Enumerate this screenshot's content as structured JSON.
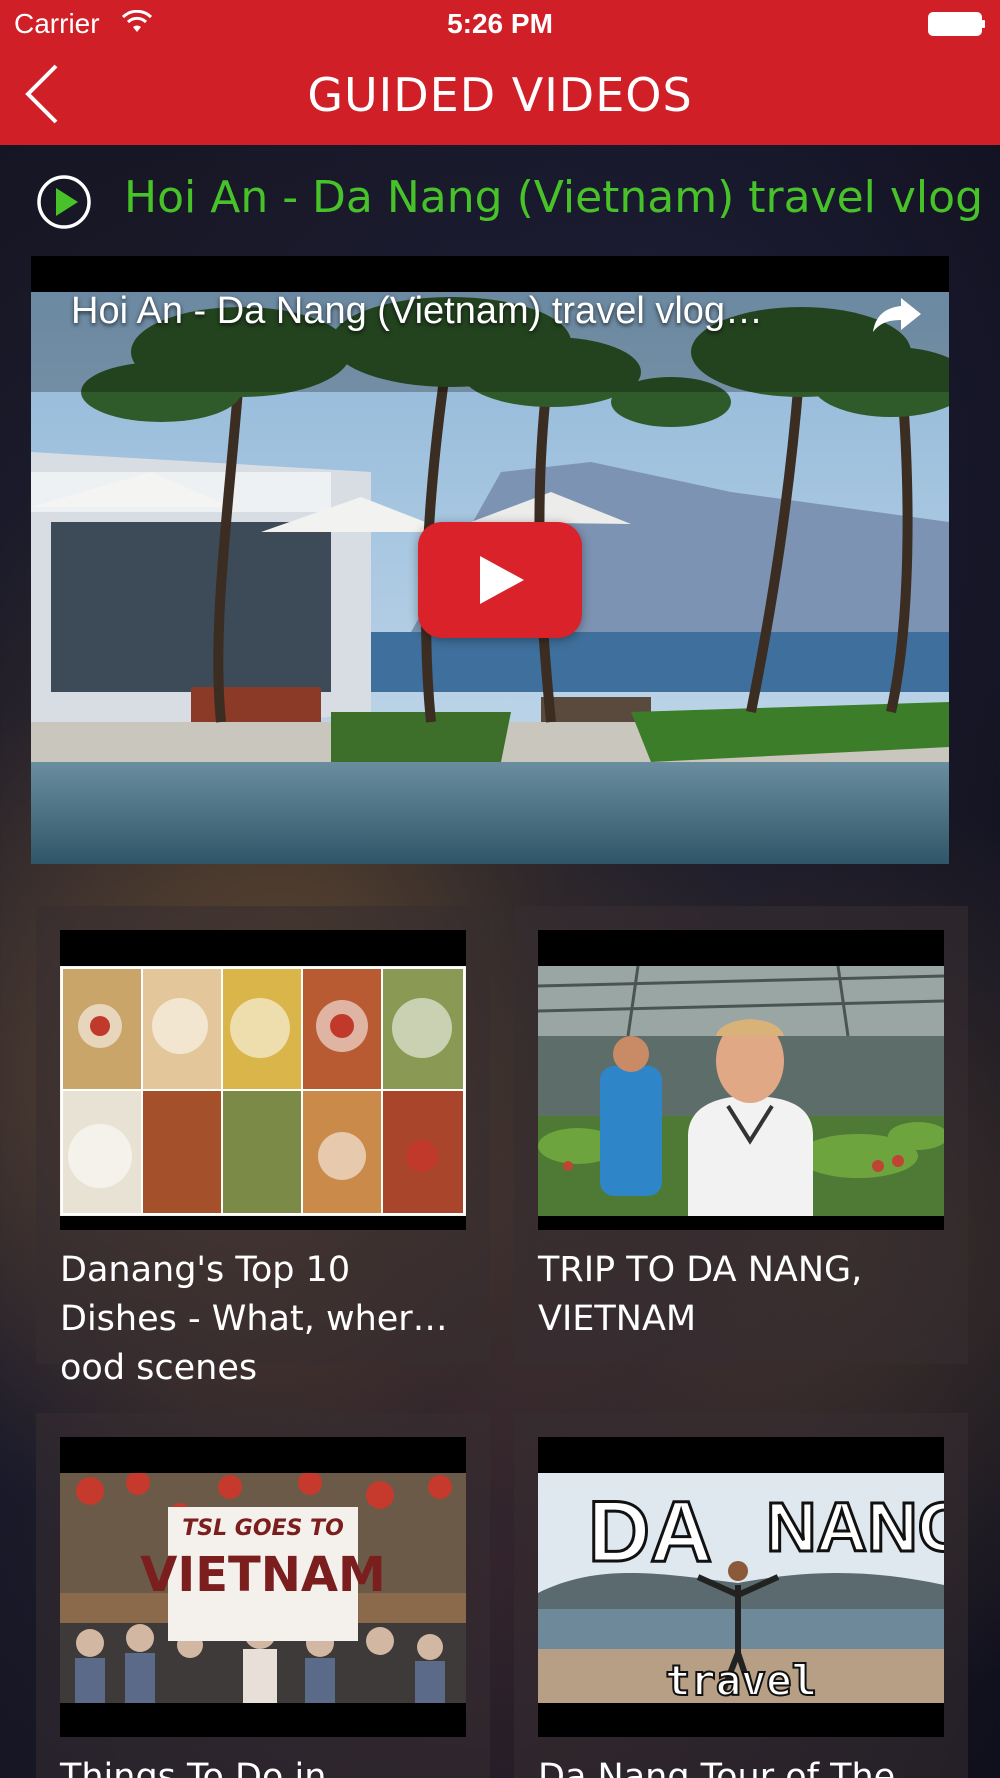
{
  "status_bar": {
    "carrier": "Carrier",
    "time": "5:26 PM"
  },
  "nav": {
    "title": "GUIDED VIDEOS",
    "back_icon": "chevron-left-icon"
  },
  "featured": {
    "title": "Hoi An - Da Nang (Vietnam) travel vlog",
    "player_title": "Hoi An - Da Nang (Vietnam) travel vlog…",
    "title_color": "#48c229"
  },
  "videos": [
    {
      "title": "Danang's Top 10 Dishes - What, wher…ood scenes"
    },
    {
      "title": "TRIP TO DA NANG, VIETNAM"
    },
    {
      "title": "Things To Do in Danang",
      "thumb_text": [
        "TSL GOES TO",
        "VIETNAM"
      ]
    },
    {
      "title": "Da Nang Tour of The",
      "thumb_text": [
        "DA",
        "NANG",
        "travel"
      ]
    }
  ],
  "colors": {
    "header": "#d01f26",
    "accent_green": "#48c229",
    "youtube_red": "#d9222a"
  }
}
